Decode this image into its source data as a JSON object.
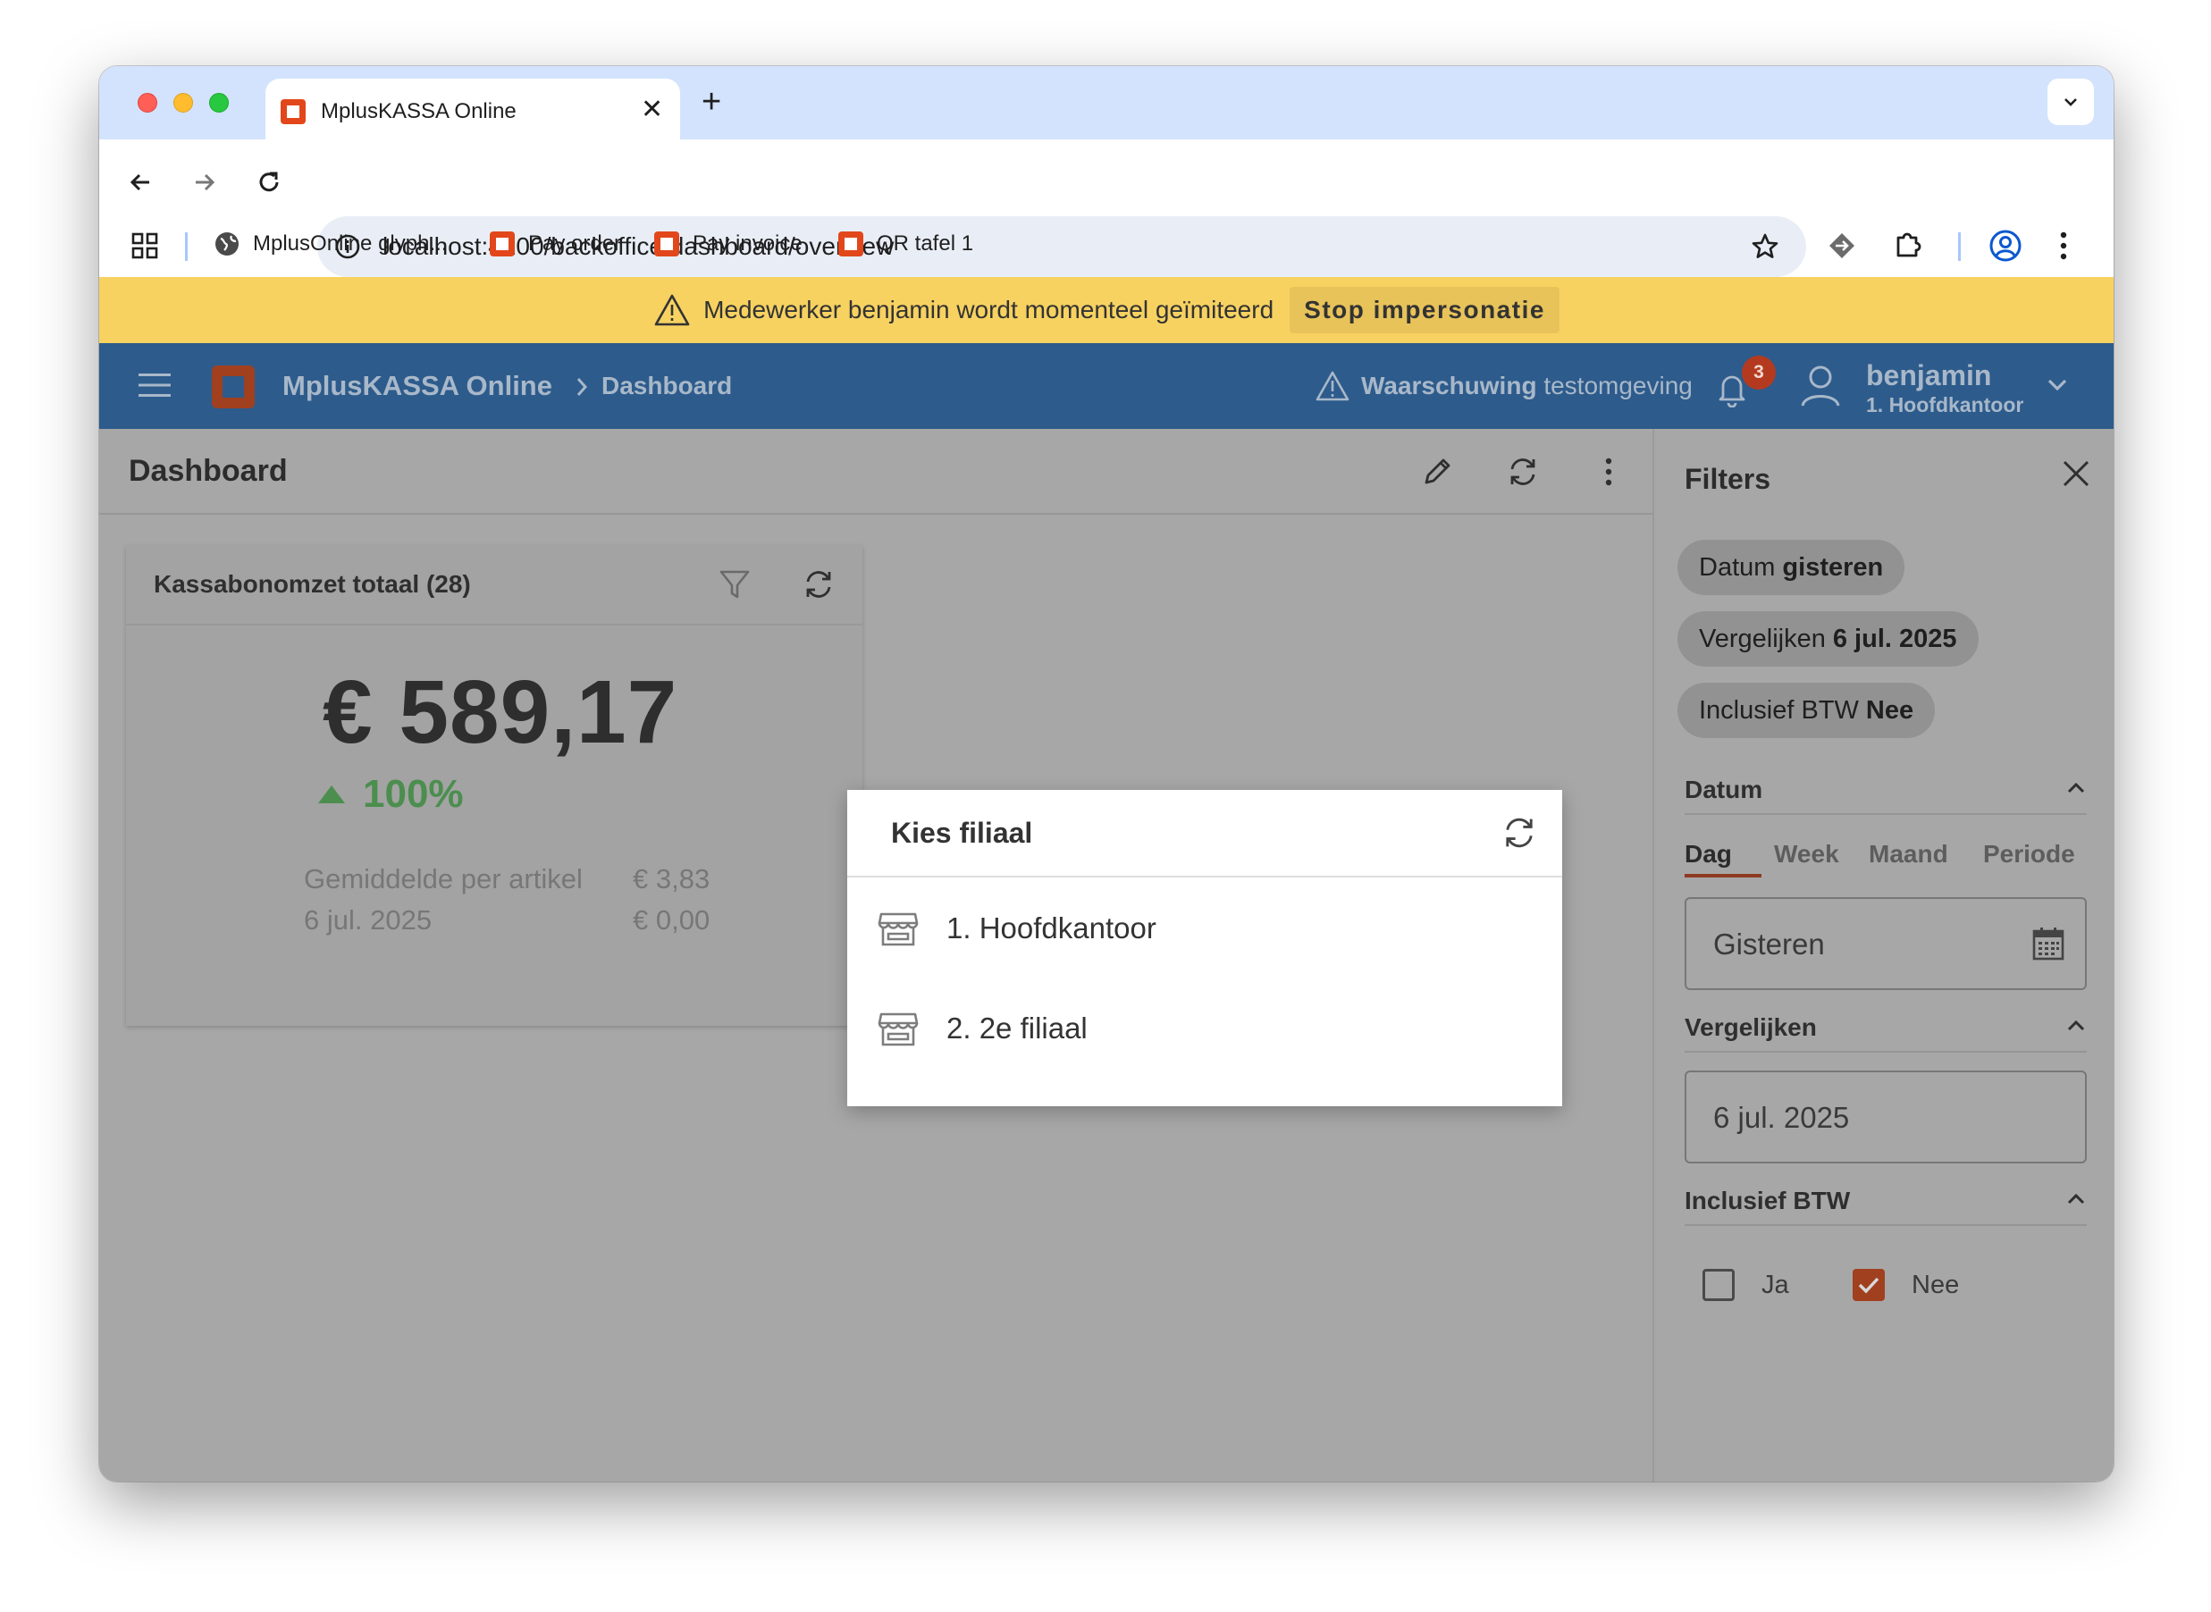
{
  "browser": {
    "tab_title": "MplusKASSA Online",
    "url": "localhost:4200/backoffice/dashboard/overview",
    "bookmarks": [
      "MplusOnline glyph...",
      "Pay order",
      "Pay invoice",
      "QR tafel 1"
    ]
  },
  "banner": {
    "message": "Medewerker benjamin wordt momenteel geïmiteerd",
    "action": "Stop impersonatie"
  },
  "appbar": {
    "title": "MplusKASSA Online",
    "crumb": "Dashboard",
    "warning_strong": "Waarschuwing",
    "warning_rest": "testomgeving",
    "notif_count": "3",
    "user_name": "benjamin",
    "user_branch": "1. Hoofdkantoor"
  },
  "dashboard": {
    "title": "Dashboard",
    "card": {
      "title": "Kassabonomzet totaal (28)",
      "amount": "€ 589,17",
      "change": "100%",
      "avg_label": "Gemiddelde per artikel",
      "avg_value": "€ 3,83",
      "compare_label": "6 jul. 2025",
      "compare_value": "€ 0,00"
    }
  },
  "dialog": {
    "title": "Kies filiaal",
    "items": [
      "1. Hoofdkantoor",
      "2. 2e filiaal"
    ]
  },
  "filters": {
    "title": "Filters",
    "chips": [
      {
        "label": "Datum",
        "value": "gisteren"
      },
      {
        "label": "Vergelijken",
        "value": "6 jul. 2025"
      },
      {
        "label": "Inclusief BTW",
        "value": "Nee"
      }
    ],
    "datum": {
      "title": "Datum",
      "tabs": [
        "Dag",
        "Week",
        "Maand",
        "Periode"
      ],
      "value": "Gisteren"
    },
    "vergelijken": {
      "title": "Vergelijken",
      "value": "6 jul. 2025"
    },
    "btw": {
      "title": "Inclusief BTW",
      "ja": "Ja",
      "nee": "Nee"
    }
  },
  "colors": {
    "banner": "#f7d261",
    "appbar": "#2d5b8c",
    "accent": "#b43a1f",
    "positive": "#4b8e4e"
  }
}
